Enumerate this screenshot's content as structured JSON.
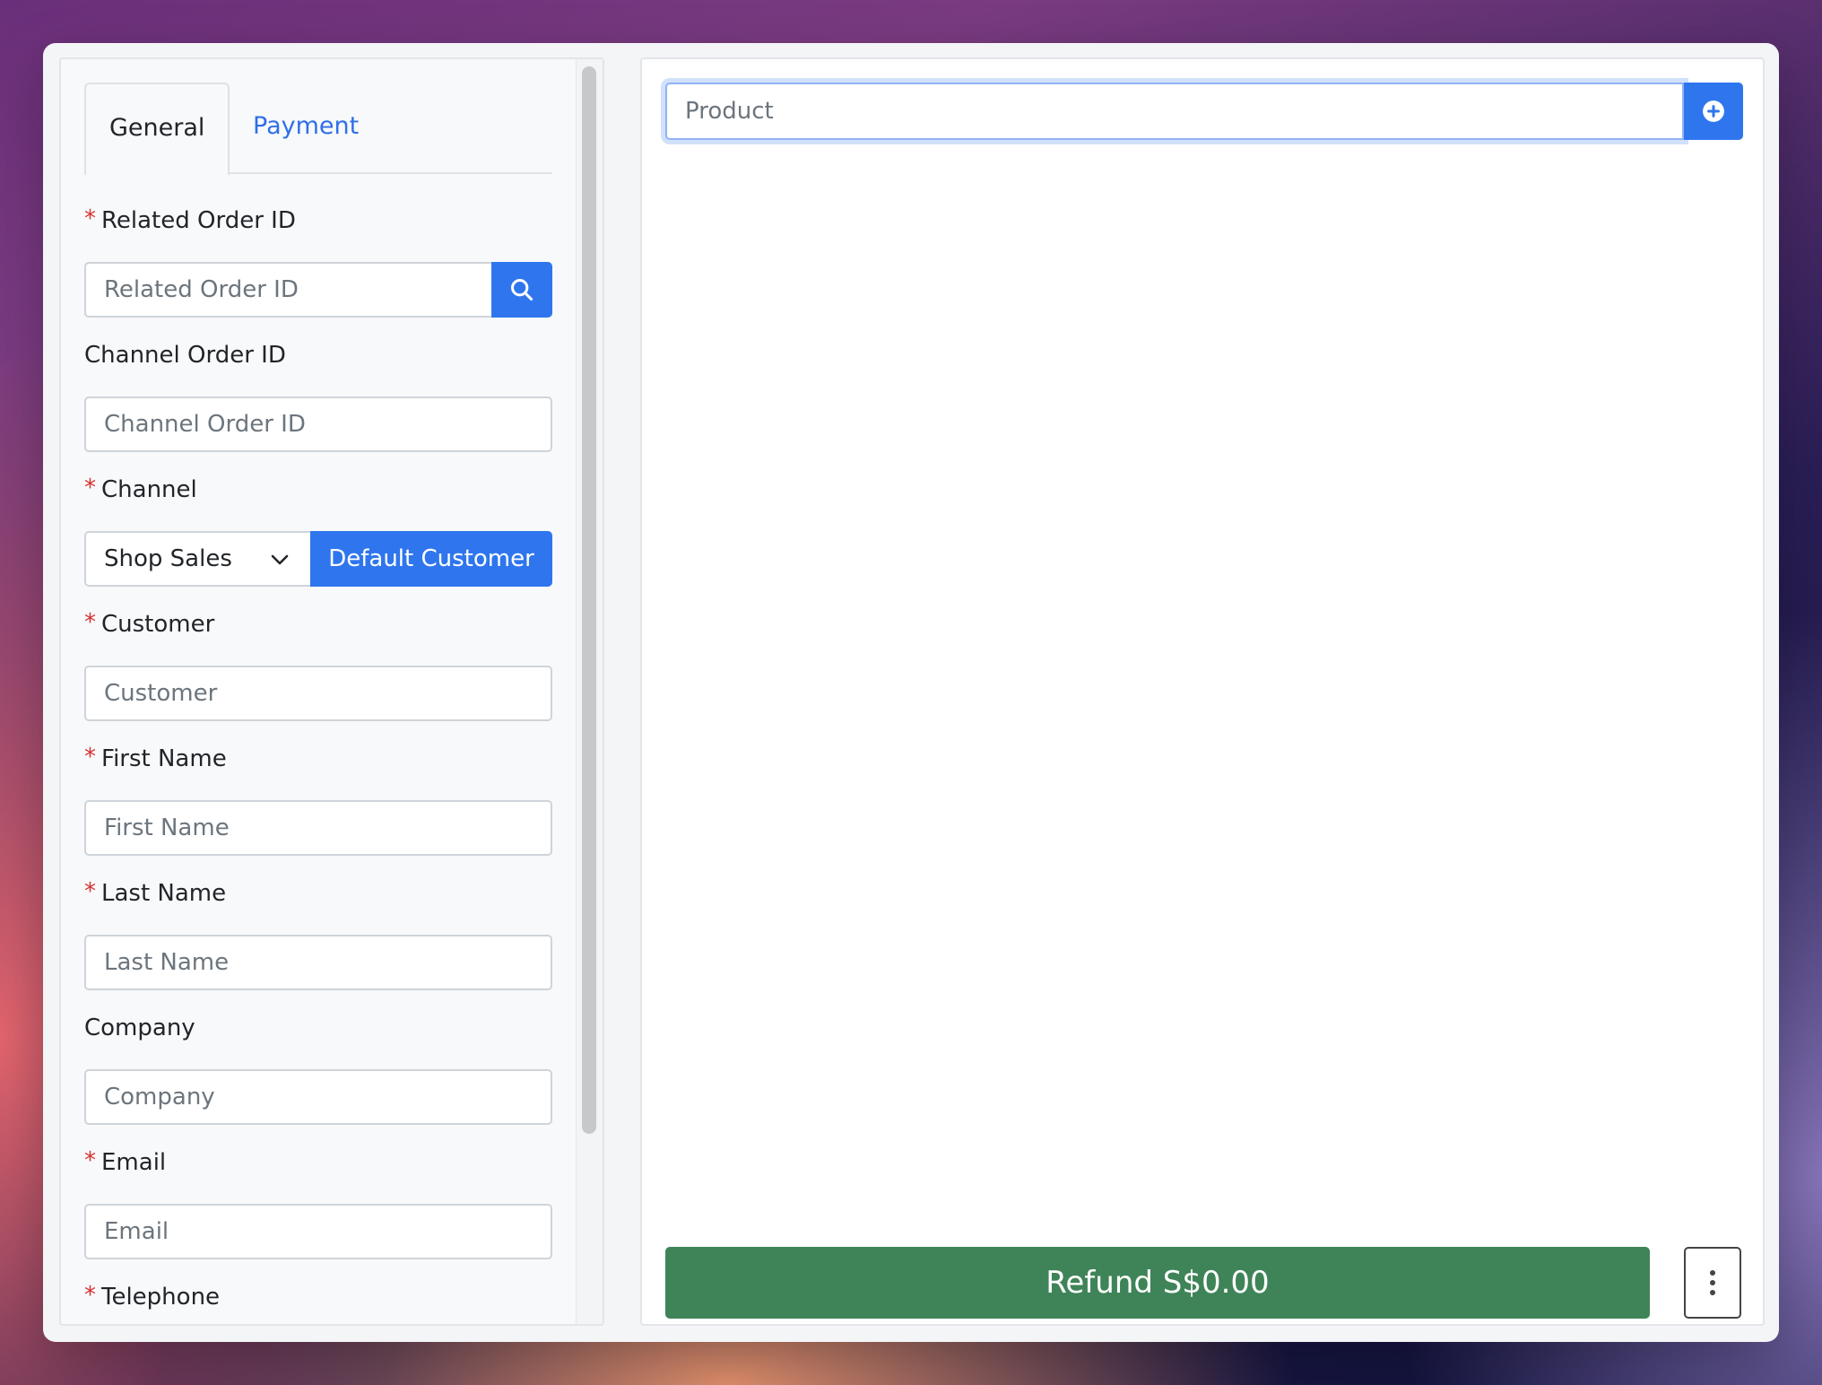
{
  "tabs": [
    {
      "label": "General",
      "active": true
    },
    {
      "label": "Payment",
      "active": false
    }
  ],
  "fields": {
    "related_order_id": {
      "label": "Related Order ID",
      "placeholder": "Related Order ID",
      "required": true
    },
    "channel_order_id": {
      "label": "Channel Order ID",
      "placeholder": "Channel Order ID",
      "required": false
    },
    "channel": {
      "label": "Channel",
      "value": "Shop Sales",
      "required": true,
      "button": "Default Customer"
    },
    "customer": {
      "label": "Customer",
      "placeholder": "Customer",
      "required": true
    },
    "first_name": {
      "label": "First Name",
      "placeholder": "First Name",
      "required": true
    },
    "last_name": {
      "label": "Last Name",
      "placeholder": "Last Name",
      "required": true
    },
    "company": {
      "label": "Company",
      "placeholder": "Company",
      "required": false
    },
    "email": {
      "label": "Email",
      "placeholder": "Email",
      "required": true
    },
    "telephone": {
      "label": "Telephone",
      "placeholder": "",
      "required": true
    }
  },
  "required_marker": "*",
  "product": {
    "placeholder": "Product"
  },
  "refund": {
    "label": "Refund S$0.00"
  },
  "icons": {
    "search": "search-icon",
    "add": "plus-circle-icon",
    "more": "vertical-dots-icon",
    "chevron": "chevron-down-icon"
  },
  "colors": {
    "primary": "#2f76ee",
    "success": "#3f8458",
    "required": "#d63232"
  }
}
